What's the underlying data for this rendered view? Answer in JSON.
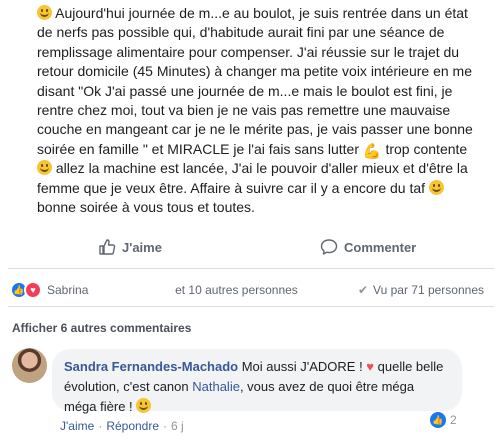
{
  "post": {
    "text_segments": [
      {
        "t": " Aujourd'hui journée de m...e au boulot, je suis rentrée dans un état de nerfs pas possible qui, d'habitude aurait fini par une séance de remplissage alimentaire pour compenser. J'ai réussie sur le trajet du retour domicile (45 Minutes) à changer ma petite voix intérieure en me disant \"Ok J'ai passé une journée de m...e mais le boulot est fini, je rentre chez moi, tout va bien je ne vais pas remettre une mauvaise couche en mangeant car je ne le mérite pas, je vais passer une bonne soirée en famille \" et MIRACLE je l'ai fais sans lutter "
      },
      {
        "t": " trop contente "
      },
      {
        "t": " allez la machine est lancée, J'ai le pouvoir d'aller mieux et d'être la femme que je veux être. Affaire à suivre car il y a encore du taf "
      },
      {
        "t": " bonne soirée à vous tous et toutes."
      }
    ]
  },
  "actions": {
    "like_label": "J'aime",
    "comment_label": "Commenter"
  },
  "reactions": {
    "reactor_name": "Sabrina",
    "others": "et 10 autres personnes",
    "seen_by": "Vu par 71 personnes"
  },
  "comments": {
    "more_label": "Afficher 6 autres commentaires",
    "items": [
      {
        "author": "Sandra Fernandes-Machado",
        "text_before": " Moi aussi J'ADORE ! ",
        "text_mid": " quelle belle évolution, c'est canon ",
        "mention": "Nathalie",
        "text_after": ", vous avez de quoi être méga méga fière ! ",
        "likes": "2",
        "like_action": "J'aime",
        "reply_action": "Répondre",
        "time": "6 j"
      }
    ]
  },
  "colors": {
    "link": "#385898",
    "like_blue": "#1877f2",
    "love_red": "#f33e58",
    "muted": "#606770"
  }
}
